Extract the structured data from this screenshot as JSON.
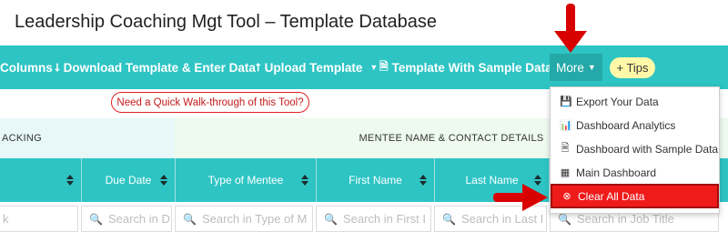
{
  "app": {
    "title": "Leadership Coaching Mgt Tool – Template Database"
  },
  "toolbar": {
    "columns_label": "Columns",
    "download_label": "Download Template & Enter Data",
    "upload_label": "Upload Template",
    "sample_label": "Template With Sample Data",
    "more_label": "More",
    "tips_label": "+ Tips"
  },
  "help": {
    "label": "Need a Quick Walk-through of this Tool?"
  },
  "groups": {
    "tracking": "ACKING",
    "mentee": "MENTEE NAME & CONTACT DETAILS"
  },
  "columns": [
    {
      "label": ""
    },
    {
      "label": "Due Date"
    },
    {
      "label": "Type of Mentee"
    },
    {
      "label": "First Name"
    },
    {
      "label": "Last Name"
    },
    {
      "label": ""
    }
  ],
  "search": [
    {
      "placeholder": "k"
    },
    {
      "placeholder": "Search in D"
    },
    {
      "placeholder": "Search in Type of M"
    },
    {
      "placeholder": "Search in First I"
    },
    {
      "placeholder": "Search in Last I"
    },
    {
      "placeholder": "Search in Job Title"
    }
  ],
  "more_menu": [
    {
      "label": "Export Your Data",
      "icon": "export-icon"
    },
    {
      "label": "Dashboard Analytics",
      "icon": "bar-chart-icon"
    },
    {
      "label": "Dashboard with Sample Data",
      "icon": "document-icon"
    },
    {
      "label": "Main Dashboard",
      "icon": "table-icon"
    },
    {
      "label": "Clear All Data",
      "icon": "clear-icon"
    }
  ],
  "colors": {
    "accent": "#2ec4c4",
    "danger": "#ef1b1b",
    "tips_bg": "#fff8a8"
  }
}
